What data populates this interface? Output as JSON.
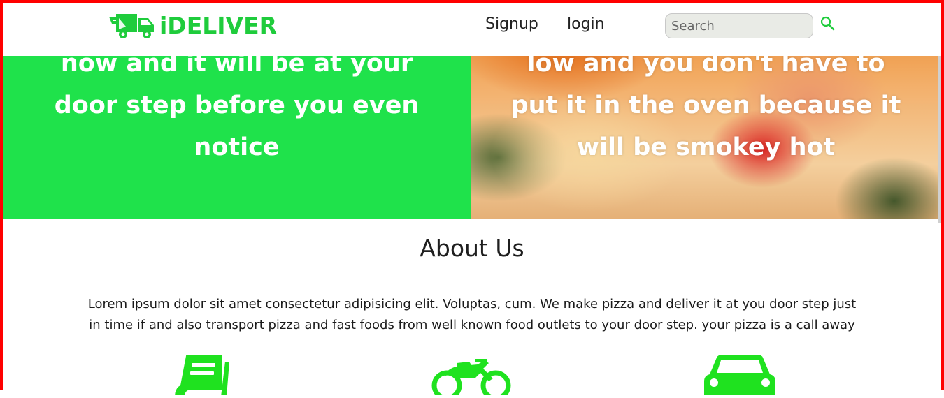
{
  "brand": {
    "name": "iDELIVER",
    "color": "#1fcc3c",
    "logo_icon": "delivery-truck-icon"
  },
  "nav": {
    "links": [
      {
        "label": "Signup"
      },
      {
        "label": "login"
      }
    ],
    "search": {
      "placeholder": "Search",
      "value": "",
      "icon": "search-icon"
    }
  },
  "hero": {
    "left": {
      "text": "now and it will be at your door step before you even notice",
      "background": "#1fe24b"
    },
    "right": {
      "text": "low and you don't have to put it in the oven because it will be smokey hot"
    }
  },
  "about": {
    "title": "About Us",
    "body": "Lorem ipsum dolor sit amet consectetur adipisicing elit. Voluptas, cum. We make pizza and deliver it at you door step just in time if and also transport pizza and fast foods from well known food outlets to your door step. your pizza is a call away"
  },
  "features": [
    {
      "icon": "book-icon"
    },
    {
      "icon": "motorcycle-icon"
    },
    {
      "icon": "car-icon"
    }
  ],
  "colors": {
    "accent": "#1fcc3c",
    "frame": "#ff0000"
  }
}
